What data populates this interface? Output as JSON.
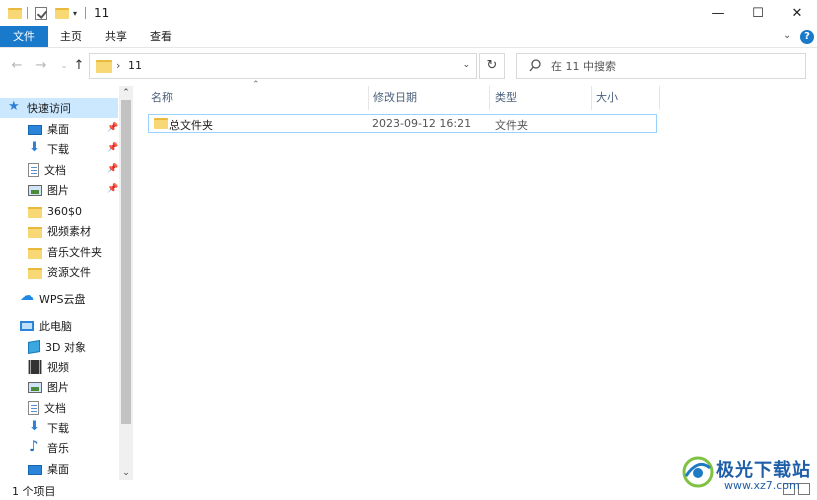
{
  "window": {
    "title": "11",
    "minimize": "—",
    "maximize": "☐",
    "close": "✕"
  },
  "ribbon": {
    "tabs": [
      "文件",
      "主页",
      "共享",
      "查看"
    ],
    "expand": "⌄",
    "help": "?"
  },
  "toolbar": {
    "back": "←",
    "forward": "→",
    "recent": "⌄",
    "up": "↑",
    "breadcrumb_sep": "›",
    "breadcrumb": "11",
    "address_dropdown": "⌄",
    "refresh": "↻",
    "search_placeholder": "在 11 中搜索"
  },
  "nav": {
    "quick_access": "快速访问",
    "quick_items": [
      {
        "label": "桌面",
        "icon": "desktop-icon",
        "pinned": true
      },
      {
        "label": "下载",
        "icon": "download-icon",
        "pinned": true
      },
      {
        "label": "文档",
        "icon": "document-icon",
        "pinned": true
      },
      {
        "label": "图片",
        "icon": "picture-icon",
        "pinned": true
      },
      {
        "label": "360$0",
        "icon": "folder-icon",
        "pinned": false
      },
      {
        "label": "视频素材",
        "icon": "folder-icon",
        "pinned": false
      },
      {
        "label": "音乐文件夹",
        "icon": "folder-icon",
        "pinned": false
      },
      {
        "label": "资源文件",
        "icon": "folder-icon",
        "pinned": false
      }
    ],
    "wps": "WPS云盘",
    "this_pc": "此电脑",
    "pc_items": [
      {
        "label": "3D 对象",
        "icon": "3d-objects-icon"
      },
      {
        "label": "视频",
        "icon": "video-icon"
      },
      {
        "label": "图片",
        "icon": "picture-icon"
      },
      {
        "label": "文档",
        "icon": "document-icon"
      },
      {
        "label": "下载",
        "icon": "download-icon"
      },
      {
        "label": "音乐",
        "icon": "music-icon"
      },
      {
        "label": "桌面",
        "icon": "desktop-icon"
      }
    ],
    "pin_glyph": "📌",
    "scroll_up": "⌃",
    "scroll_down": "⌄"
  },
  "columns": {
    "sort_glyph": "⌃",
    "name": "名称",
    "modified": "修改日期",
    "type": "类型",
    "size": "大小"
  },
  "files": [
    {
      "name": "总文件夹",
      "modified": "2023-09-12 16:21",
      "type": "文件夹",
      "size": ""
    }
  ],
  "status": {
    "count": "1 个项目"
  },
  "watermark": {
    "name": "极光下载站",
    "url": "www.xz7.com"
  },
  "colors": {
    "accent": "#1979ca",
    "selection": "#cce8ff",
    "folder": "#f8d775"
  }
}
